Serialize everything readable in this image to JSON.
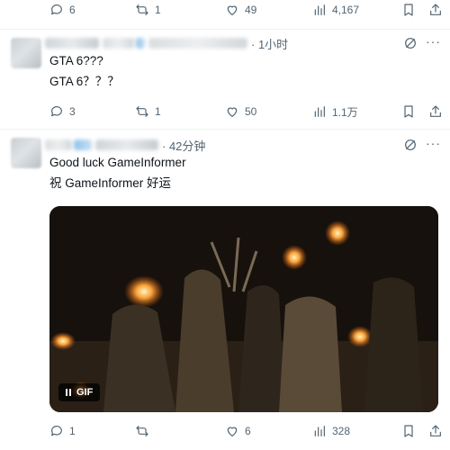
{
  "posts": [
    {
      "actions": {
        "replies": "6",
        "retweets": "1",
        "likes": "49",
        "views": "4,167"
      }
    },
    {
      "time": "· 1小时",
      "lines": [
        "GTA 6???",
        "GTA 6？？？"
      ],
      "actions": {
        "replies": "3",
        "retweets": "1",
        "likes": "50",
        "views": "1.1万"
      }
    },
    {
      "time": "· 42分钟",
      "lines": [
        "Good luck GameInformer",
        "祝 GameInformer 好运"
      ],
      "media": {
        "badge": "GIF"
      },
      "actions": {
        "replies": "1",
        "retweets": "",
        "likes": "6",
        "views": "328"
      }
    }
  ],
  "icons": [
    "reply-icon",
    "retweet-icon",
    "like-icon",
    "views-icon",
    "bookmark-icon",
    "share-icon",
    "grok-icon",
    "more-icon",
    "pause-icon"
  ]
}
